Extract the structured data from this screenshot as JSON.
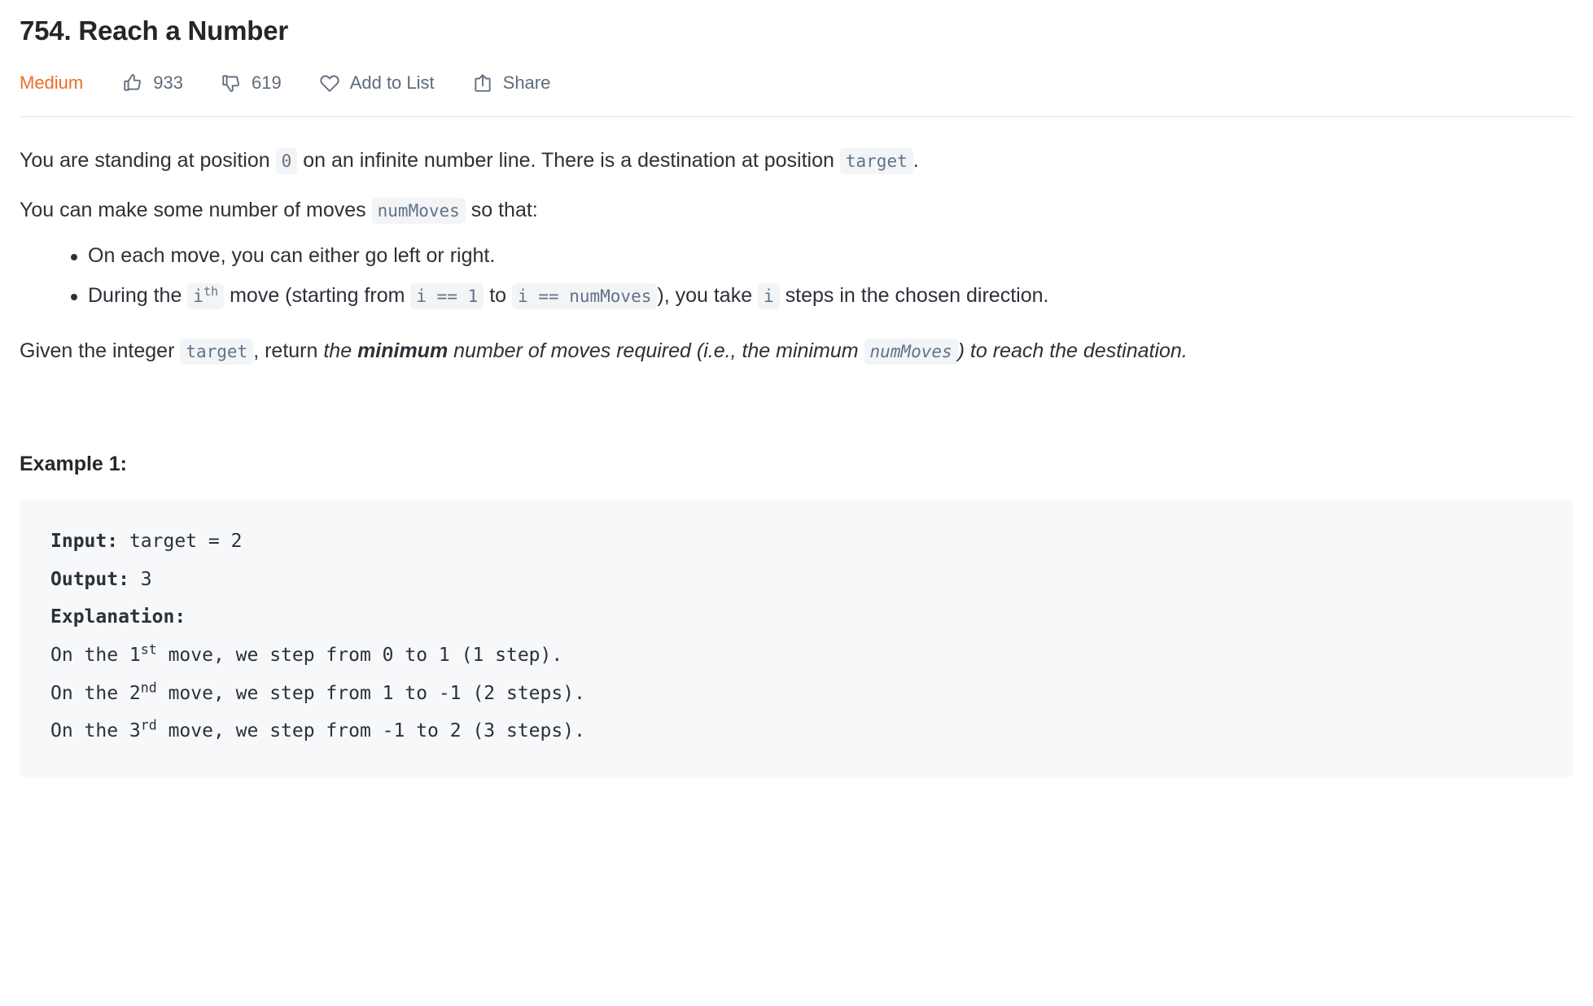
{
  "problem": {
    "title": "754. Reach a Number",
    "difficulty": "Medium"
  },
  "meta": {
    "likes": "933",
    "dislikes": "619",
    "add_to_list": "Add to List",
    "share": "Share",
    "icons": {
      "like": "thumbs-up-icon",
      "dislike": "thumbs-down-icon",
      "add_to_list": "heart-icon",
      "share": "share-icon"
    }
  },
  "colors": {
    "difficulty_orange": "#ef6c2a",
    "meta_gray": "#5f6b7a",
    "code_bg": "#f7f8fa",
    "inline_code_bg": "#f3f4f6",
    "inline_code_text": "#60728a",
    "divider": "#e5e5e5"
  },
  "description": {
    "p1": {
      "t1": "You are standing at position ",
      "c1": "0",
      "t2": " on an infinite number line. There is a destination at position ",
      "c2": "target",
      "t3": "."
    },
    "p2": {
      "t1": "You can make some number of moves ",
      "c1": "numMoves",
      "t2": " so that:"
    },
    "bullets": [
      {
        "t1": "On each move, you can either go left or right."
      },
      {
        "t1": "During the ",
        "c1": "i",
        "c1sup": "th",
        "t2": " move (starting from ",
        "c2": "i == 1",
        "t3": " to ",
        "c3": "i == numMoves",
        "t4": "), you take ",
        "c4": "i",
        "t5": " steps in the chosen direction."
      }
    ],
    "p3": {
      "t1": "Given the integer ",
      "c1": "target",
      "t2": ", return ",
      "i1": "the ",
      "b1": "minimum",
      "i2": " number of moves required (i.e., the minimum ",
      "c2": "numMoves",
      "i3": ") to reach the destination."
    }
  },
  "example": {
    "heading": "Example 1:",
    "input_label": "Input:",
    "input_value": " target = 2",
    "output_label": "Output:",
    "output_value": " 3",
    "explanation_label": "Explanation:",
    "lines": [
      {
        "pre": "On the 1",
        "sup": "st",
        "post": " move, we step from 0 to 1 (1 step)."
      },
      {
        "pre": "On the 2",
        "sup": "nd",
        "post": " move, we step from 1 to -1 (2 steps)."
      },
      {
        "pre": "On the 3",
        "sup": "rd",
        "post": " move, we step from -1 to 2 (3 steps)."
      }
    ]
  }
}
